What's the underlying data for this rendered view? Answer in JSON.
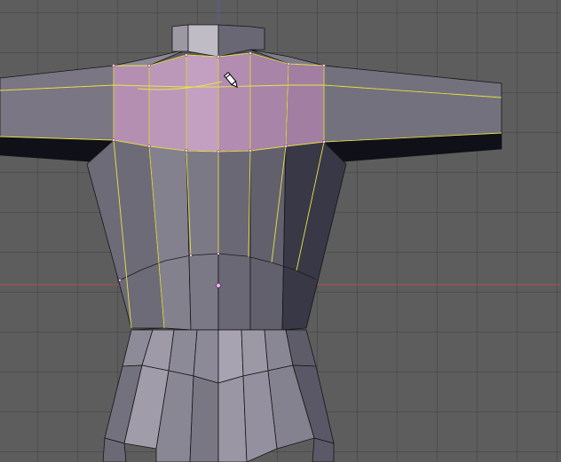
{
  "viewport": {
    "background": "#5d5d5d",
    "grid_color": "#505050",
    "x_axis_color": "#b05050",
    "y_axis_color": "#5a5ab4"
  },
  "mesh": {
    "name": "torso",
    "mode": "face-select",
    "selected_face_color": "#b28aae",
    "selected_edge_color": "#e8e34a",
    "vertex_color": "#ffc0ff",
    "base_face_color": "#7e7b86",
    "shadow_face_color": "#3c3c4a",
    "dark_edge_color": "#101010"
  },
  "cursor": {
    "icon": "pencil-cursor-icon"
  }
}
